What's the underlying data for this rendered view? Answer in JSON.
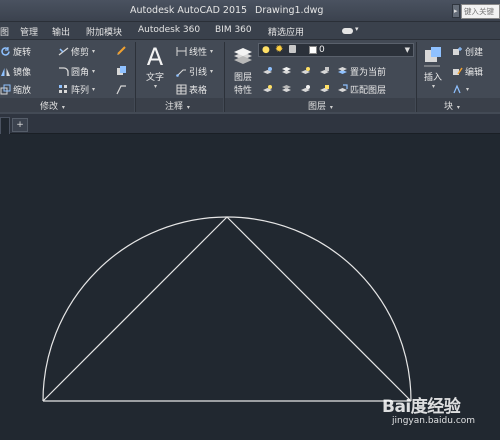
{
  "title_bar": {
    "app_title": "Autodesk AutoCAD 2015",
    "doc_title": "Drawing1.dwg",
    "search_placeholder": "键入关键",
    "side_tab_glyph": "▸"
  },
  "menu": {
    "items": [
      "图",
      "管理",
      "输出",
      "附加模块",
      "Autodesk 360",
      "BIM 360",
      "精选应用"
    ]
  },
  "ribbon": {
    "modify": {
      "label": "修改",
      "tools": [
        {
          "label": "旋转",
          "icon": "rotate-icon"
        },
        {
          "label": "镜像",
          "icon": "mirror-icon"
        },
        {
          "label": "缩放",
          "icon": "scale-icon"
        },
        {
          "label": "修剪",
          "icon": "trim-icon"
        },
        {
          "label": "圆角",
          "icon": "fillet-icon"
        },
        {
          "label": "阵列",
          "icon": "array-icon"
        }
      ]
    },
    "annotation": {
      "label": "注释",
      "text_label": "文字",
      "tools": [
        {
          "label": "线性",
          "icon": "linear-dimension-icon"
        },
        {
          "label": "引线",
          "icon": "leader-icon"
        },
        {
          "label": "表格",
          "icon": "table-icon"
        }
      ]
    },
    "layers": {
      "label": "图层",
      "properties_label_1": "图层",
      "properties_label_2": "特性",
      "current_layer": "0",
      "set_current_label": "置为当前",
      "match_layer_label": "匹配图层"
    },
    "block": {
      "label": "块",
      "insert_label": "插入",
      "create_label": "创建",
      "edit_label": "编辑"
    },
    "collapse_glyph": "▾"
  },
  "tabs": {
    "new_tab_glyph": "+"
  },
  "watermark": {
    "logo": "Bai度经验",
    "url": "jingyan.baidu.com"
  },
  "colors": {
    "canvas": "#212830",
    "ribbon": "#434a55",
    "drawing_lines": "#e6e6e6"
  }
}
